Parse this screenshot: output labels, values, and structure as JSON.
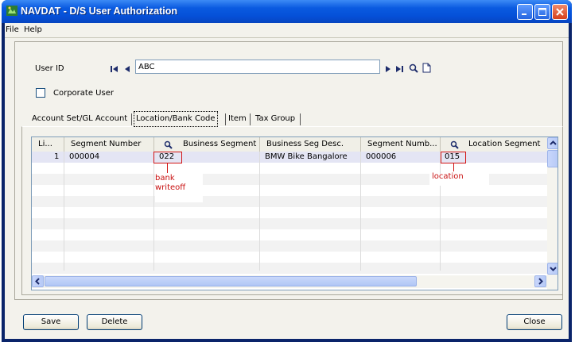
{
  "window": {
    "title": "NAVDAT - D/S User Authorization"
  },
  "menu": [
    "File",
    "Help"
  ],
  "user_id": {
    "label": "User ID",
    "value": "ABC"
  },
  "corporate_user": {
    "label": "Corporate User",
    "checked": false
  },
  "tabs": [
    {
      "label": "Account Set/GL Account",
      "active": false
    },
    {
      "label": "Location/Bank Code",
      "active": true
    },
    {
      "label": "Item",
      "active": false
    },
    {
      "label": "Tax Group",
      "active": false
    }
  ],
  "grid": {
    "columns": [
      "Li...",
      "Segment Number",
      "Business Segment",
      "Business Seg Desc.",
      "Segment Numb...",
      "Location Segment"
    ],
    "rows": [
      {
        "line": "1",
        "segment_number": "000004",
        "business_segment": "022",
        "business_seg_desc": "BMW Bike Bangalore",
        "segment_number_2": "000006",
        "location_segment": "015"
      }
    ]
  },
  "annotations": {
    "bank": "bank",
    "writeoff": "writeoff",
    "location": "location"
  },
  "buttons": {
    "save": "Save",
    "delete": "Delete",
    "close": "Close"
  }
}
